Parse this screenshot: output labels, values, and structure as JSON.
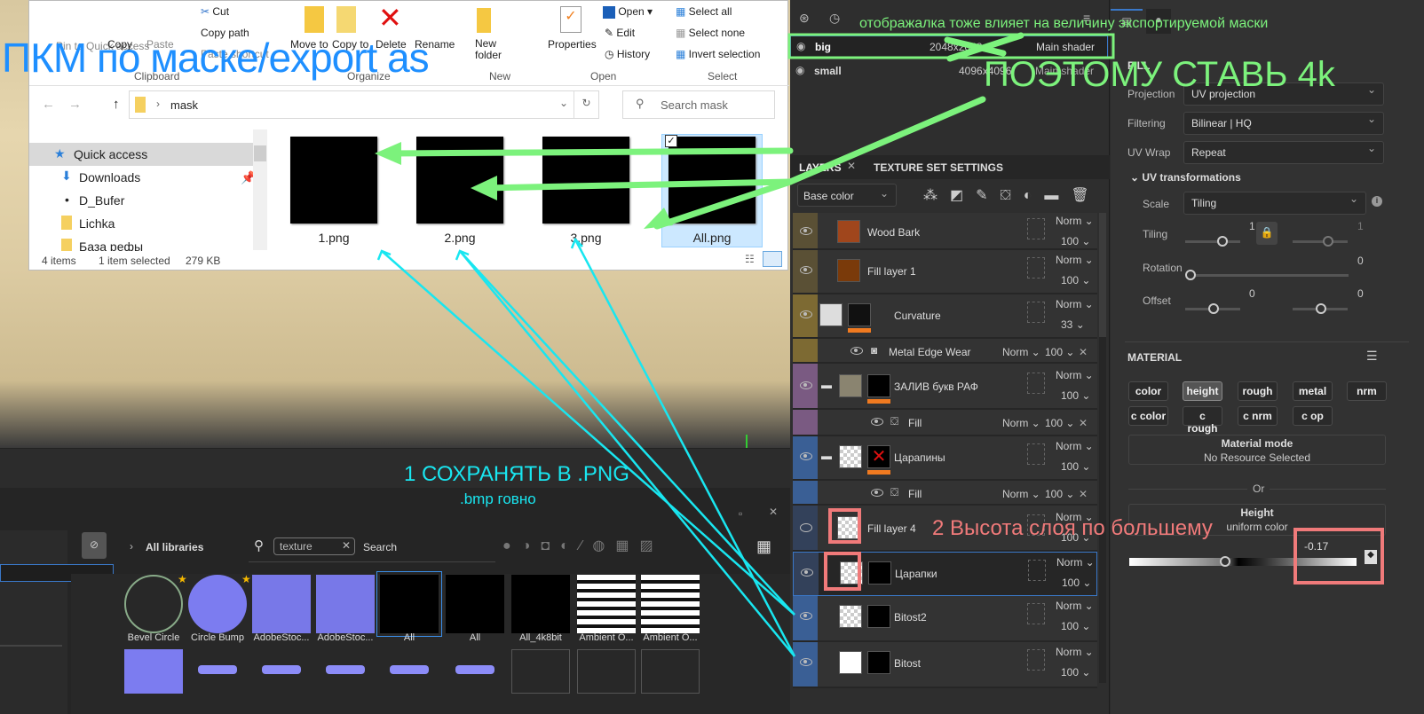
{
  "explorer": {
    "ribbon": {
      "pin": "Pin to Quick access",
      "copy": "Copy",
      "paste": "Paste",
      "cut": "Cut",
      "copy_path": "Copy path",
      "paste_shortcut": "Paste shortcut",
      "move_to": "Move to",
      "copy_to": "Copy to",
      "delete": "Delete",
      "rename": "Rename",
      "new_folder": "New folder",
      "properties": "Properties",
      "open": "Open",
      "edit": "Edit",
      "history": "History",
      "select_all": "Select all",
      "select_none": "Select none",
      "invert_selection": "Invert selection"
    },
    "groups": {
      "clipboard": "Clipboard",
      "organize": "Organize",
      "new": "New",
      "open": "Open",
      "select": "Select"
    },
    "address": "mask",
    "search_placeholder": "Search mask",
    "nav": [
      "Quick access",
      "Downloads",
      "D_Bufer",
      "Lichka",
      "База рефы"
    ],
    "files": [
      "1.png",
      "2.png",
      "3.png",
      "All.png"
    ],
    "status": {
      "items": "4 items",
      "selected": "1 item selected",
      "size": "279 KB"
    }
  },
  "texture_sets": [
    {
      "name": "big",
      "size": "2048x2048",
      "shader": "Main shader"
    },
    {
      "name": "small",
      "size": "4096x4096",
      "shader": "Main shader"
    }
  ],
  "layers_panel": {
    "tab_layers": "LAYERS",
    "tab_tss": "TEXTURE SET SETTINGS",
    "channel": "Base color",
    "layers": [
      {
        "name": "Wood Bark",
        "blend": "Norm",
        "opacity": "100"
      },
      {
        "name": "Fill layer 1",
        "blend": "Norm",
        "opacity": "100"
      },
      {
        "name": "Curvature",
        "blend": "Norm",
        "opacity": "33"
      },
      {
        "name": "Metal Edge Wear",
        "blend": "Norm",
        "opacity": "100"
      },
      {
        "name": "ЗАЛИВ букв РАФ",
        "blend": "Norm",
        "opacity": "100"
      },
      {
        "name": "Fill",
        "blend": "Norm",
        "opacity": "100"
      },
      {
        "name": "Царапины",
        "blend": "Norm",
        "opacity": "100"
      },
      {
        "name": "Fill",
        "blend": "Norm",
        "opacity": "100"
      },
      {
        "name": "Fill layer 4",
        "blend": "Norm",
        "opacity": "100"
      },
      {
        "name": "Царапки",
        "blend": "Norm",
        "opacity": "100"
      },
      {
        "name": "Bitost2",
        "blend": "Norm",
        "opacity": "100"
      },
      {
        "name": "Bitost",
        "blend": "Norm",
        "opacity": "100"
      }
    ]
  },
  "properties": {
    "section": "FILL",
    "projection_label": "Projection",
    "projection": "UV projection",
    "filtering_label": "Filtering",
    "filtering": "Bilinear | HQ",
    "uvwrap_label": "UV Wrap",
    "uvwrap": "Repeat",
    "uvt": "UV transformations",
    "scale_label": "Scale",
    "scale": "Tiling",
    "tiling_label": "Tiling",
    "tiling_u": "1",
    "tiling_v": "1",
    "rotation_label": "Rotation",
    "rotation": "0",
    "offset_label": "Offset",
    "offset_u": "0",
    "offset_v": "0",
    "material": "MATERIAL",
    "chips": [
      "color",
      "height",
      "rough",
      "metal",
      "nrm",
      "c color",
      "c rough",
      "c nrm",
      "c op"
    ],
    "material_mode": "Material mode",
    "no_resource": "No Resource Selected",
    "or": "Or",
    "height": "Height",
    "uniform": "uniform color",
    "height_value": "-0.17",
    "height_fraction": 0.42
  },
  "library": {
    "all_libraries": "All libraries",
    "search_value": "texture",
    "search_label": "Search",
    "assets": [
      "Bevel Circle",
      "Circle Bump",
      "AdobeStoc...",
      "AdobeStoc...",
      "All",
      "All",
      "All_4k8bit",
      "Ambient O...",
      "Ambient O..."
    ]
  },
  "annotations": {
    "rmb": "ПКМ по маске/export as",
    "display_note": "отображалка тоже влияет на величину экспортируемой маски",
    "set4k": "ПОЭТОМУ СТАВЬ 4k",
    "save_png": "1 СОХРАНЯТЬ В .PNG",
    "bmp": ".bmp говно",
    "height_note": "2 Высота слоя по большему"
  },
  "colors": {
    "green": "#7cf27c",
    "cyan": "#19e6f0",
    "blue": "#1e8fff",
    "pink": "#f07a7a"
  }
}
